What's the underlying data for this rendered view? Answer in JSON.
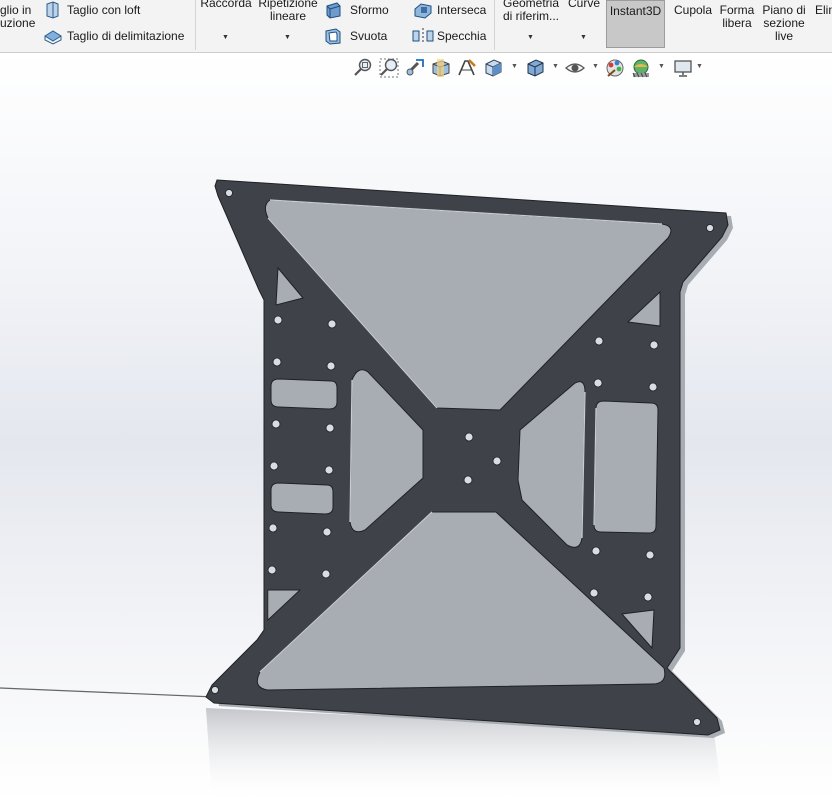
{
  "ribbon": {
    "cut_revolve_line1": "glio in",
    "cut_revolve_line2": "uzione",
    "loft_cut": "Taglio con loft",
    "boundary_cut": "Taglio di delimitazione",
    "fillet": "Raccorda",
    "linear_pattern_line1": "Ripetizione",
    "linear_pattern_line2": "lineare",
    "draft": "Sformo",
    "shell": "Svuota",
    "intersect": "Interseca",
    "mirror": "Specchia",
    "ref_geometry_line1": "Geometria",
    "ref_geometry_line2": "di riferim...",
    "curves": "Curve",
    "instant3d": "Instant3D",
    "dome": "Cupola",
    "freeform_line1": "Forma",
    "freeform_line2": "libera",
    "live_section_line1": "Piano di",
    "live_section_line2": "sezione",
    "live_section_line3": "live",
    "cut_off": "Elim"
  },
  "heads_up_toolbar": {
    "icons": [
      "zoom-to-fit-icon",
      "zoom-to-area-icon",
      "previous-view-icon",
      "section-view-icon",
      "dynamic-annotation-icon",
      "view-orientation-icon",
      "display-style-icon",
      "hide-show-items-icon",
      "edit-appearance-icon",
      "apply-scene-icon",
      "view-settings-icon"
    ]
  },
  "colors": {
    "part": "#3f4349",
    "part_edge": "#c8ccd2",
    "active_button": "#c8c8c8"
  }
}
